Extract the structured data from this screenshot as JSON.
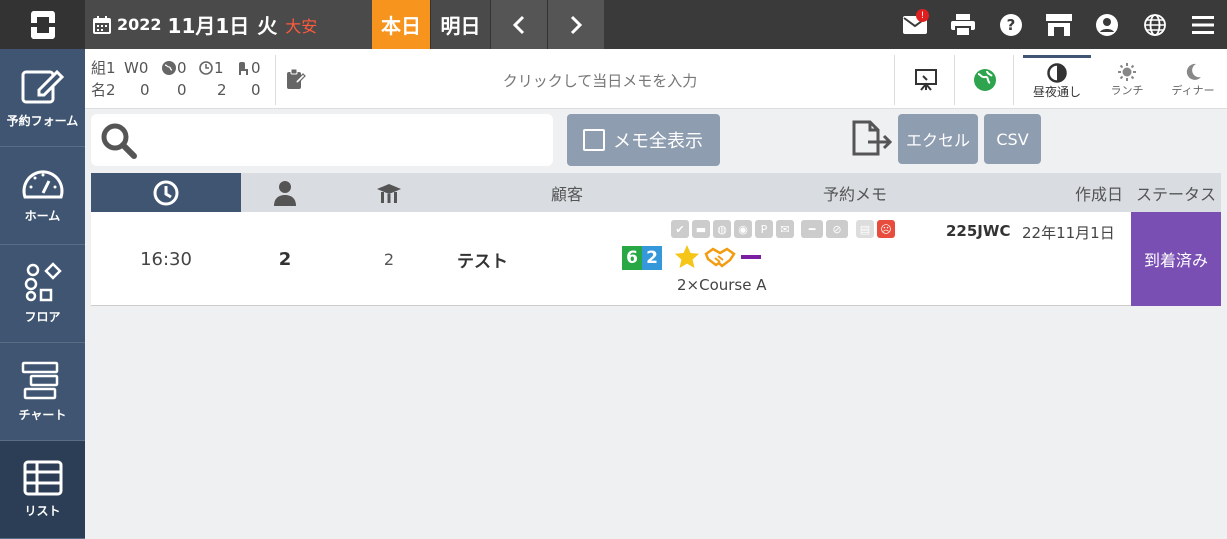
{
  "header": {
    "year": "2022",
    "date": "11月1日",
    "weekday": "火",
    "rokuyo": "大安",
    "today_label": "本日",
    "tomorrow_label": "明日",
    "mail_badge": "!"
  },
  "sidebar": {
    "items": [
      {
        "label": "予約フォーム"
      },
      {
        "label": "ホーム"
      },
      {
        "label": "フロア"
      },
      {
        "label": "チャート"
      },
      {
        "label": "リスト"
      }
    ]
  },
  "summary": {
    "groups_label": "組",
    "names_label": "名",
    "row1": [
      "1",
      "W0",
      "0",
      "1",
      "0"
    ],
    "row2": [
      "2",
      "0",
      "0",
      "2",
      "0"
    ],
    "memo_placeholder": "クリックして当日メモを入力",
    "meals": {
      "all": "昼夜通し",
      "lunch": "ランチ",
      "dinner": "ディナー"
    }
  },
  "toolbar": {
    "memo_toggle": "メモ全表示",
    "excel": "エクセル",
    "csv": "CSV"
  },
  "table": {
    "headers": {
      "customer": "顧客",
      "memo": "予約メモ",
      "created": "作成日",
      "status": "ステータス"
    },
    "rows": [
      {
        "time": "16:30",
        "people": "2",
        "table": "2",
        "customer": "テスト",
        "tag_a": "6",
        "tag_b": "2",
        "course": "2×Course A",
        "code": "225JWC",
        "created": "22年11月1日",
        "status": "到着済み"
      }
    ]
  },
  "colors": {
    "accent": "#f7941d",
    "sidebar": "#3f5571",
    "status": "#7a4fb3"
  }
}
